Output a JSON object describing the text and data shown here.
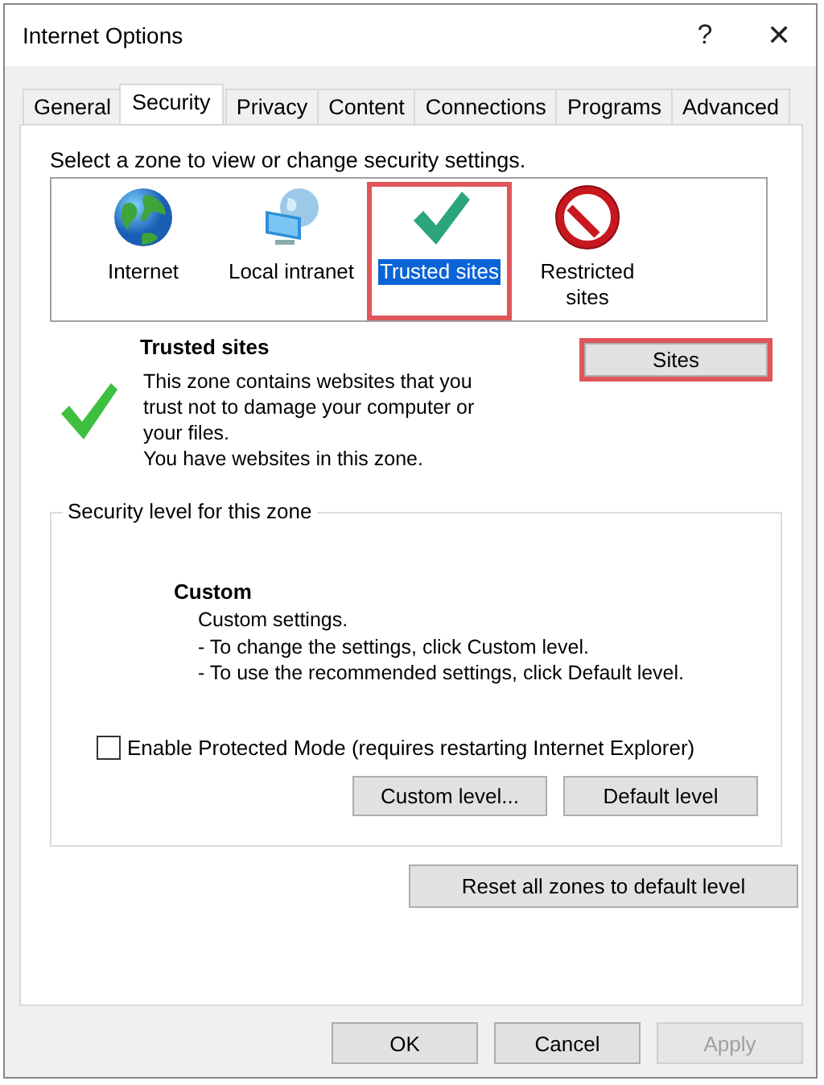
{
  "window": {
    "title": "Internet Options",
    "help": "?",
    "close": "✕"
  },
  "tabs": [
    {
      "label": "General",
      "selected": false
    },
    {
      "label": "Security",
      "selected": true
    },
    {
      "label": "Privacy",
      "selected": false
    },
    {
      "label": "Content",
      "selected": false
    },
    {
      "label": "Connections",
      "selected": false
    },
    {
      "label": "Programs",
      "selected": false
    },
    {
      "label": "Advanced",
      "selected": false
    }
  ],
  "zone_prompt": "Select a zone to view or change security settings.",
  "zones": [
    {
      "kind": "globe",
      "label": "Internet",
      "selected": false,
      "highlighted": false
    },
    {
      "kind": "intranet",
      "label": "Local intranet",
      "selected": false,
      "highlighted": false
    },
    {
      "kind": "check",
      "label": "Trusted sites",
      "selected": true,
      "highlighted": true
    },
    {
      "kind": "restricted",
      "label": "Restricted sites",
      "selected": false,
      "highlighted": false
    }
  ],
  "zone_info": {
    "title": "Trusted sites",
    "description": "This zone contains websites that you trust not to damage your computer or your files.",
    "note": "You have websites in this zone.",
    "sites_button": {
      "label": "Sites",
      "highlighted": true
    }
  },
  "security_level": {
    "legend": "Security level for this zone",
    "level_name": "Custom",
    "lines": [
      "Custom settings.",
      "- To change the settings, click Custom level.",
      "- To use the recommended settings, click Default level."
    ],
    "protected_mode": {
      "label": "Enable Protected Mode (requires restarting Internet Explorer)",
      "checked": false
    },
    "buttons": [
      {
        "label": "Custom level..."
      },
      {
        "label": "Default level"
      }
    ]
  },
  "reset_button": "Reset all zones to default level",
  "dialog_buttons": [
    {
      "label": "OK",
      "disabled": false
    },
    {
      "label": "Cancel",
      "disabled": false
    },
    {
      "label": "Apply",
      "disabled": true
    }
  ]
}
